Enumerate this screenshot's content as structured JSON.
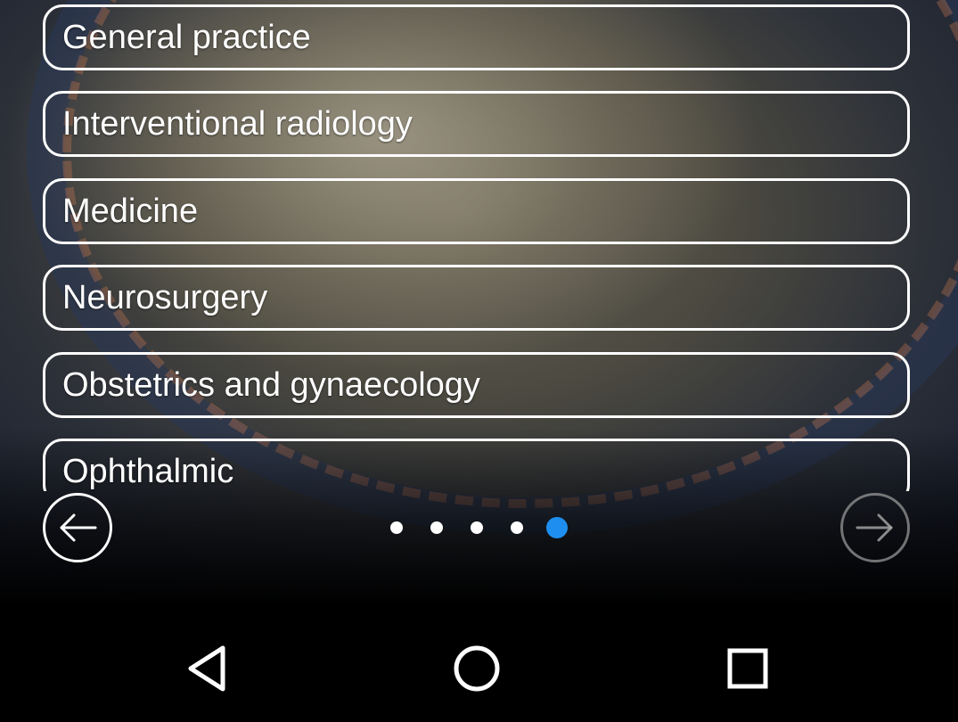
{
  "list": {
    "items": [
      {
        "label": "General practice"
      },
      {
        "label": "Interventional radiology"
      },
      {
        "label": "Medicine"
      },
      {
        "label": "Neurosurgery"
      },
      {
        "label": "Obstetrics and gynaecology"
      },
      {
        "label": "Ophthalmic"
      }
    ]
  },
  "pager": {
    "total_pages": 5,
    "current_page": 5,
    "active_color": "#1e8ff0",
    "inactive_color": "#ffffff",
    "prev_icon": "arrow-left-icon",
    "next_icon": "arrow-right-icon"
  },
  "navigation_bar": {
    "back_icon": "triangle-back-icon",
    "home_icon": "circle-home-icon",
    "recents_icon": "square-recents-icon"
  }
}
